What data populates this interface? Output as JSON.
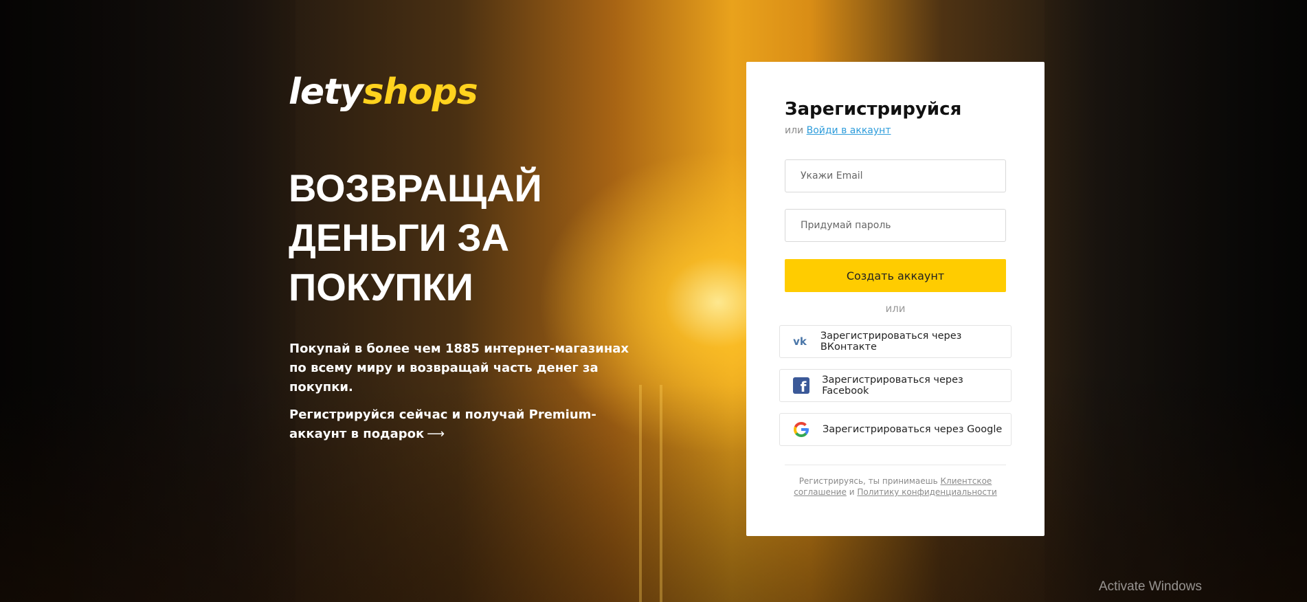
{
  "brand": {
    "part1": "lety",
    "part2": "shops"
  },
  "hero": {
    "headline": [
      "ВОЗВРАЩАЙ",
      "ДЕНЬГИ ЗА",
      "ПОКУПКИ"
    ],
    "promo1": "Покупай в более чем 1885 интернет-магазинах по всему миру и возвращай часть денег за покупки.",
    "promo2": "Регистрируйся сейчас и получай Premium-аккаунт в подарок",
    "arrow": "⟶"
  },
  "form": {
    "title": "Зарегистрируйся",
    "alt_prefix": "или",
    "login_link": "Войди в аккаунт",
    "email_placeholder": "Укажи Email",
    "password_placeholder": "Придумай пароль",
    "submit_label": "Создать аккаунт",
    "or_label": "или",
    "social": {
      "vk": "Зарегистрироваться через ВКонтакте",
      "facebook": "Зарегистрироваться через Facebook",
      "google": "Зарегистрироваться через Google"
    },
    "legal": {
      "prefix": "Регистрируясь, ты принимаешь",
      "agreement": "Клиентское соглашение",
      "and": "и",
      "privacy": "Политику конфиденциальности"
    }
  },
  "system": {
    "watermark": "Activate Windows"
  },
  "colors": {
    "accent": "#ffcc00",
    "link": "#2d9cdb",
    "vk": "#4a76a8",
    "facebook": "#3b5998"
  }
}
